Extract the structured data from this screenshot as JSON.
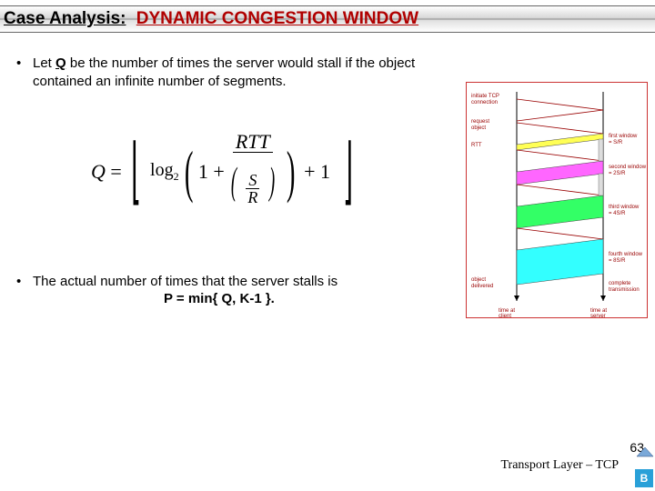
{
  "title": {
    "part1": "Case Analysis:",
    "part2": "DYNAMIC CONGESTION WINDOW"
  },
  "bullet1": {
    "pre": "Let ",
    "Q": "Q",
    "post": " be the number of times the server would stall if the object contained an infinite number of segments."
  },
  "formula": {
    "Q": "Q",
    "eq": " = ",
    "log": "log",
    "sub2": "2",
    "one_plus": "1 + ",
    "RTT": "RTT",
    "S": "S",
    "R": "R",
    "plus1": " + 1"
  },
  "bullet2": "The actual number of times that the server stalls is",
  "pline": "P = min{ Q, K-1 }.",
  "diagram": {
    "top_left1": "initiate TCP",
    "top_left2": "connection",
    "req1": "request",
    "req2": "object",
    "win1": "first window",
    "win1b": "= S/R",
    "win2": "second window",
    "win2b": "= 2S/R",
    "win3": "third window",
    "win3b": "= 4S/R",
    "win4": "fourth window",
    "win4b": "= 8S/R",
    "obj": "object",
    "deliv": "delivered",
    "complete": "complete",
    "transmission": "transmission",
    "time_c": "time at",
    "client": "client",
    "time_s": "time at",
    "server": "server",
    "rtt": "RTT"
  },
  "footer": {
    "page": "63",
    "label": "Transport Layer – TCP",
    "badge": "B"
  }
}
